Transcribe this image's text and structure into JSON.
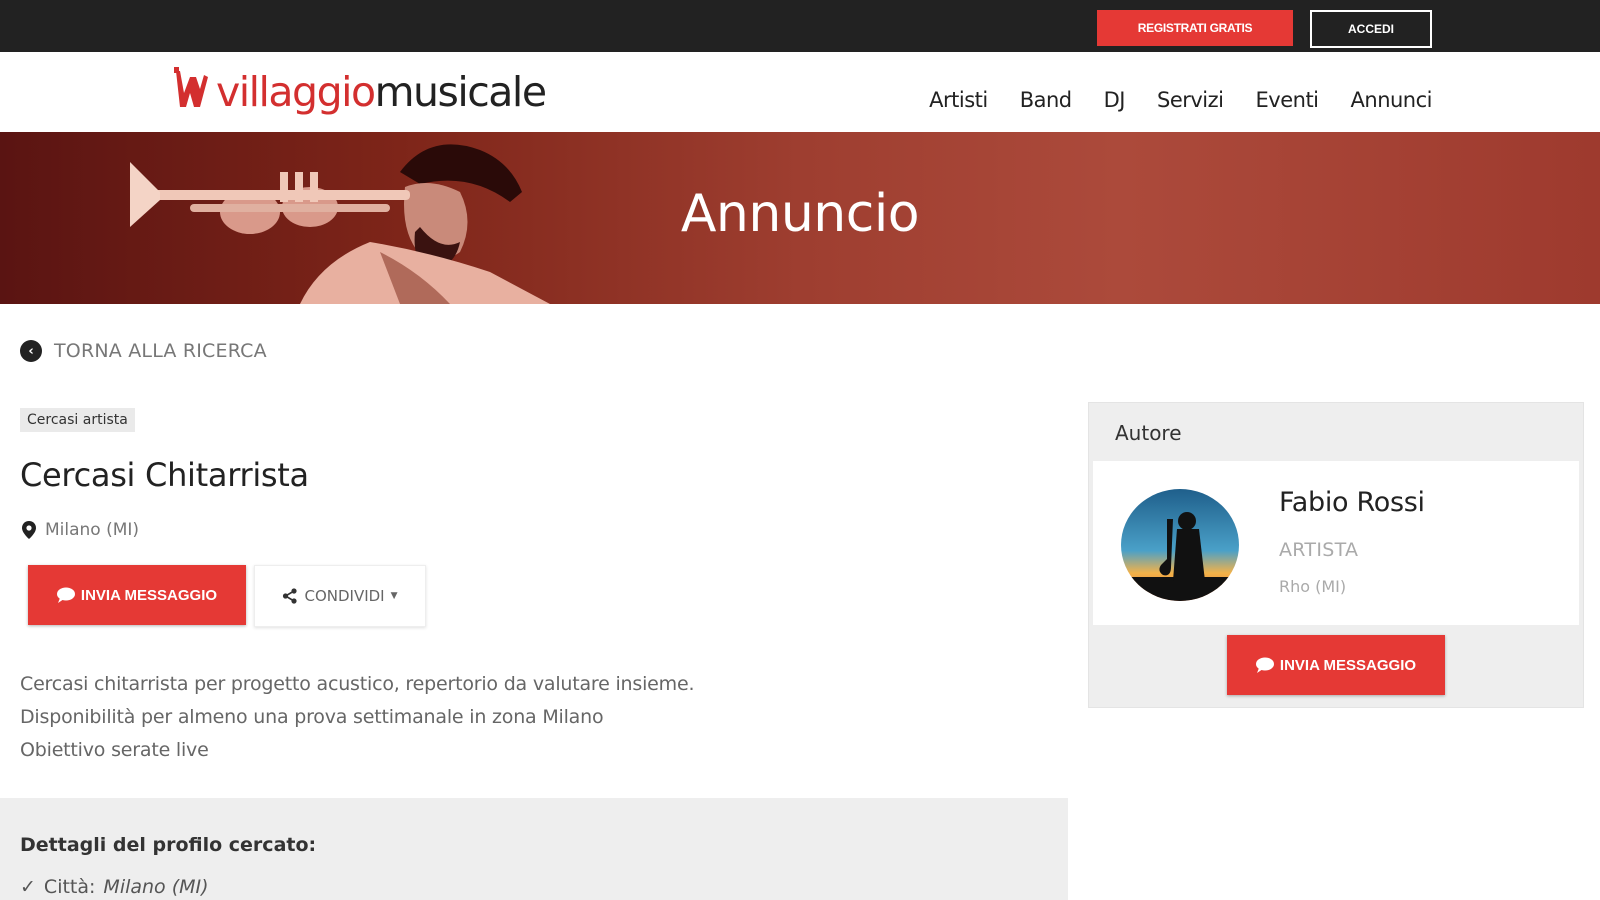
{
  "topbar": {
    "register_label": "REGISTRATI GRATIS",
    "login_label": "ACCEDI"
  },
  "header": {
    "logo_part1": "villaggio",
    "logo_part2": "musicale",
    "nav": [
      "Artisti",
      "Band",
      "DJ",
      "Servizi",
      "Eventi",
      "Annunci"
    ]
  },
  "banner": {
    "title": "Annuncio"
  },
  "back_link": {
    "label": "TORNA ALLA RICERCA"
  },
  "ad": {
    "category_tag": "Cercasi artista",
    "title": "Cercasi Chitarrista",
    "location": "Milano (MI)",
    "send_label": "INVIA MESSAGGIO",
    "share_label": "CONDIVIDI",
    "description": [
      "Cercasi chitarrista per progetto acustico, repertorio da valutare insieme.",
      "Disponibilità per almeno una prova settimanale in zona Milano",
      "Obiettivo serate live"
    ]
  },
  "details": {
    "title": "Dettagli del profilo cercato:",
    "city_label": "Città:",
    "city_value": "Milano (MI)"
  },
  "author": {
    "heading": "Autore",
    "name": "Fabio Rossi",
    "role": "ARTISTA",
    "city": "Rho (MI)",
    "send_label": "INVIA MESSAGGIO"
  },
  "colors": {
    "brand_red": "#e53935",
    "topbar": "#222222",
    "banner": "#9e3e30"
  }
}
